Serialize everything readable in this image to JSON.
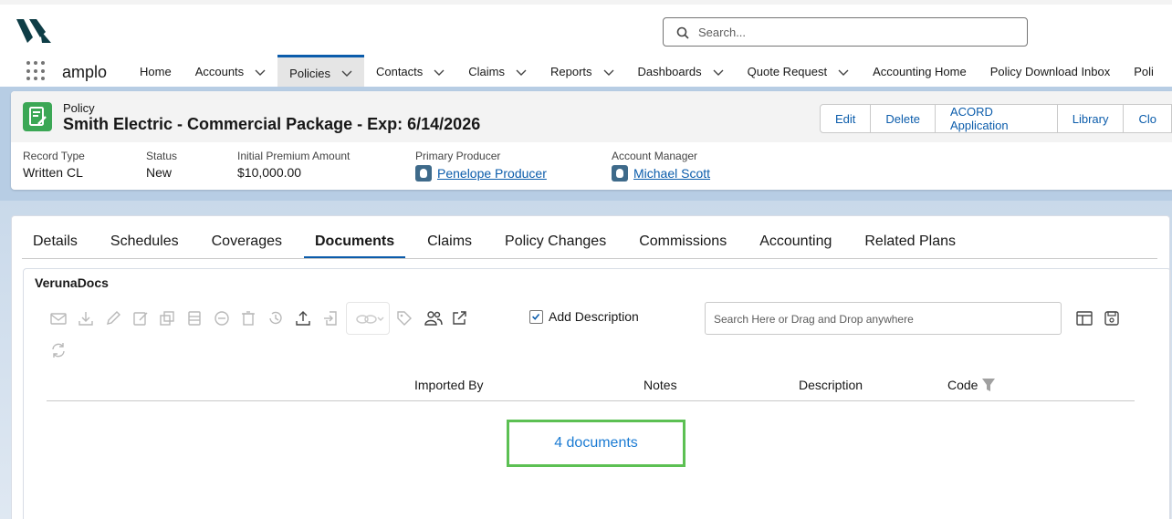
{
  "app": {
    "name": "amplo",
    "search_placeholder": "Search..."
  },
  "nav": {
    "items": [
      {
        "label": "Home",
        "chevron": false
      },
      {
        "label": "Accounts",
        "chevron": true
      },
      {
        "label": "Policies",
        "chevron": true,
        "active": true
      },
      {
        "label": "Contacts",
        "chevron": true
      },
      {
        "label": "Claims",
        "chevron": true
      },
      {
        "label": "Reports",
        "chevron": true
      },
      {
        "label": "Dashboards",
        "chevron": true
      },
      {
        "label": "Quote Request",
        "chevron": true
      },
      {
        "label": "Accounting Home",
        "chevron": false
      },
      {
        "label": "Policy Download Inbox",
        "chevron": false
      },
      {
        "label": "Poli",
        "chevron": false
      }
    ]
  },
  "record": {
    "kind": "Policy",
    "title": "Smith Electric - Commercial Package - Exp: 6/14/2026",
    "actions": [
      "Edit",
      "Delete",
      "ACORD Application",
      "Library",
      "Clo"
    ],
    "fields": {
      "record_type": {
        "label": "Record Type",
        "value": "Written CL"
      },
      "status": {
        "label": "Status",
        "value": "New"
      },
      "premium": {
        "label": "Initial Premium Amount",
        "value": "$10,000.00"
      },
      "producer": {
        "label": "Primary Producer",
        "value": "Penelope Producer"
      },
      "manager": {
        "label": "Account Manager",
        "value": "Michael Scott"
      }
    }
  },
  "tabs": [
    "Details",
    "Schedules",
    "Coverages",
    "Documents",
    "Claims",
    "Policy Changes",
    "Commissions",
    "Accounting",
    "Related Plans"
  ],
  "active_tab": "Documents",
  "docs": {
    "panel_title": "VerunaDocs",
    "add_description_label": "Add Description",
    "add_description_checked": true,
    "search_placeholder": "Search Here or Drag and Drop anywhere",
    "columns": [
      "Imported By",
      "Notes",
      "Description",
      "Code"
    ],
    "count_label": "4 documents"
  },
  "colors": {
    "brand_link": "#0b5cab",
    "policy_icon": "#3ba755",
    "highlight_box": "#5cc053"
  }
}
